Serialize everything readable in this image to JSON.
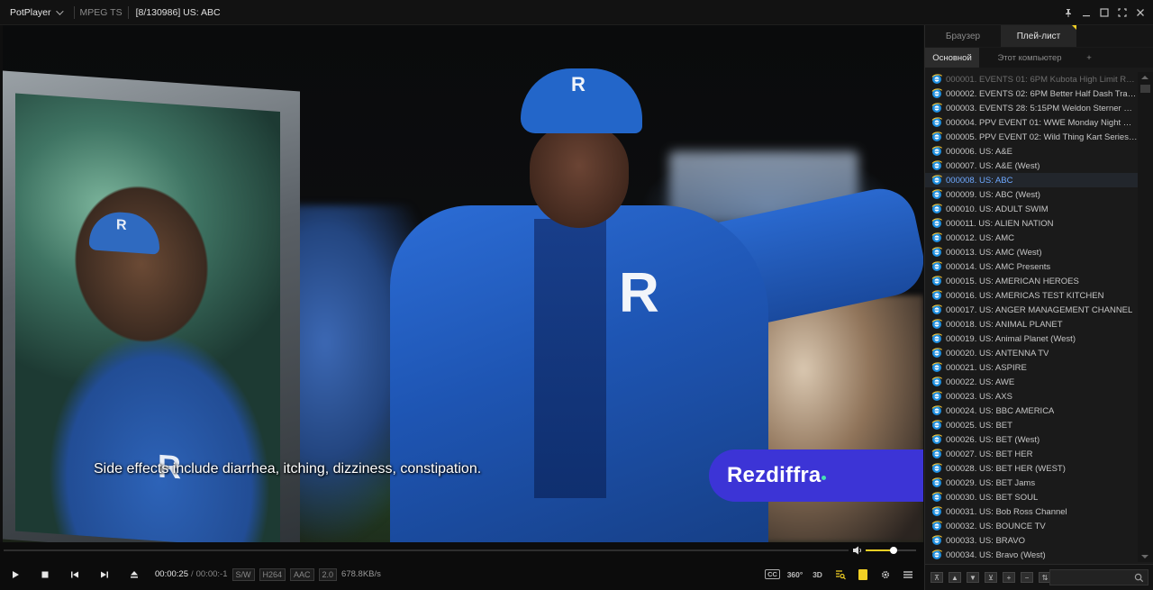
{
  "titlebar": {
    "app_name": "PotPlayer",
    "format": "MPEG TS",
    "title": "[8/130986] US: ABC",
    "controls": [
      "pin-icon",
      "minimize-icon",
      "maximize-icon",
      "fullscreen-icon",
      "close-icon"
    ]
  },
  "video": {
    "subtitle": "Side effects include diarrhea, itching, dizziness, constipation.",
    "ad_logo": "Rezdiffra"
  },
  "seek": {
    "progress": 0.0
  },
  "volume": {
    "level": 0.55
  },
  "controls": {
    "buttons": [
      "play-icon",
      "stop-icon",
      "previous-icon",
      "next-icon",
      "eject-icon"
    ],
    "time_current": "00:00:25",
    "time_separator": "/",
    "time_total": "00:00:-1",
    "tags": [
      "S/W",
      "H264",
      "AAC",
      "2.0"
    ],
    "bitrate": "678.8KB/s",
    "tools": [
      "CC",
      "360°",
      "3D"
    ]
  },
  "panel": {
    "tabs": [
      "Браузер",
      "Плей-лист"
    ],
    "subtabs": [
      "Основной",
      "Этот компьютер",
      "+"
    ],
    "active_tab": 1,
    "active_subtab": 0,
    "current_index": 7,
    "items": [
      "000001. EVENTS 01: 6PM Kubota High Limit Rac...",
      "000002. EVENTS 02: 6PM Better Half Dash Track...",
      "000003. EVENTS 28: 5:15PM Weldon Sterner Me...",
      "000004. PPV EVENT 01: WWE Monday Night RA...",
      "000005. PPV EVENT 02: Wild Thing Kart Series at...",
      "000006. US: A&E",
      "000007. US: A&E (West)",
      "000008. US: ABC",
      "000009. US: ABC (West)",
      "000010. US: ADULT SWIM",
      "000011. US: ALIEN NATION",
      "000012. US: AMC",
      "000013. US: AMC (West)",
      "000014. US: AMC Presents",
      "000015. US: AMERICAN HEROES",
      "000016. US: AMERICAS TEST KITCHEN",
      "000017. US: ANGER MANAGEMENT CHANNEL",
      "000018. US: ANIMAL PLANET",
      "000019. US: Animal Planet (West)",
      "000020. US: ANTENNA TV",
      "000021. US: ASPIRE",
      "000022. US: AWE",
      "000023. US: AXS",
      "000024. US: BBC AMERICA",
      "000025. US: BET",
      "000026. US: BET (West)",
      "000027. US: BET HER",
      "000028. US: BET HER (WEST)",
      "000029. US: BET Jams",
      "000030. US: BET SOUL",
      "000031. US: Bob Ross Channel",
      "000032. US: BOUNCE TV",
      "000033. US: BRAVO",
      "000034. US: Bravo (West)"
    ],
    "bottom_buttons": [
      "⊼",
      "▲",
      "▼",
      "⊻",
      "+",
      "−",
      "⇅"
    ],
    "search_placeholder": ""
  },
  "colors": {
    "accent": "#6fa9ff",
    "volume": "#f2d024",
    "ad_banner": "#3c34d6"
  }
}
